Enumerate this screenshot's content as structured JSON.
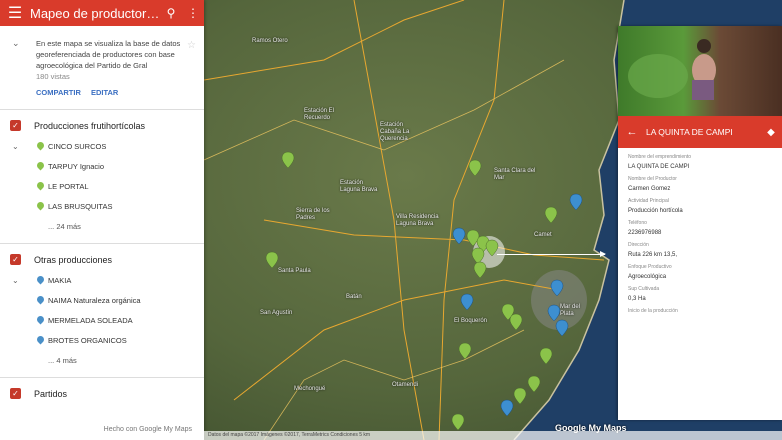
{
  "app": {
    "title": "Mapeo de productores ...",
    "description": "En este mapa se visualiza la base de datos georeferenciada de productores con base agroecológica del Partido de Gral",
    "views": "180 vistas",
    "share_label": "COMPARTIR",
    "edit_label": "EDITAR",
    "footer_text": "Hecho con Google My Maps"
  },
  "layers": [
    {
      "name": "Producciones frutihortícolas",
      "items": [
        "CINCO SURCOS",
        "TARPUY Ignacio",
        "LE PORTAL",
        "LAS BRUSQUITAS"
      ],
      "more": "... 24 más",
      "pin_color": "#8bc34a"
    },
    {
      "name": "Otras producciones",
      "items": [
        "MAKIA",
        "NAIMA Naturaleza orgánica",
        "MERMELADA SOLEADA",
        "BROTES ORGANICOS"
      ],
      "more": "... 4 más",
      "pin_color": "#4a90c8"
    },
    {
      "name": "Partidos",
      "items": [],
      "more": ""
    }
  ],
  "card": {
    "title": "LA QUINTA DE CAMPI",
    "fields": [
      {
        "label": "Nombre del emprendimiento",
        "value": "LA QUINTA DE CAMPI"
      },
      {
        "label": "Nombre del Productor",
        "value": "Carmen Gomez"
      },
      {
        "label": "Actividad Principal",
        "value": "Producción hortícola"
      },
      {
        "label": "Teléfono",
        "value": "2236976988"
      },
      {
        "label": "Dirección",
        "value": "Ruta 226 km 13,5,"
      },
      {
        "label": "Enfoque Productivo",
        "value": "Agroecológica"
      },
      {
        "label": "Sup Cultivada",
        "value": "0,3 Ha"
      },
      {
        "label": "Inicio de la producción",
        "value": ""
      }
    ]
  },
  "map": {
    "places": [
      "Ramos Otero",
      "Estación El Recuerdo",
      "Estación Cabaña La Querencia",
      "Estación Laguna Brava",
      "Villa Residencia Laguna Brava",
      "Sierra de los Padres",
      "El Boquerón",
      "San Agustín",
      "Batán",
      "Santa Paula",
      "Mechongué",
      "Otamendi",
      "Santa Clara del Mar",
      "Camet",
      "Mar del Plata"
    ],
    "attribution": "Datos del mapa ©2017 Imágenes ©2017, TerraMetrics   Condiciones   5 km",
    "logo": "Google My Maps",
    "colors": {
      "brand_red": "#d93b2b",
      "pin_green": "#8bc34a",
      "pin_blue": "#4a90c8"
    }
  }
}
